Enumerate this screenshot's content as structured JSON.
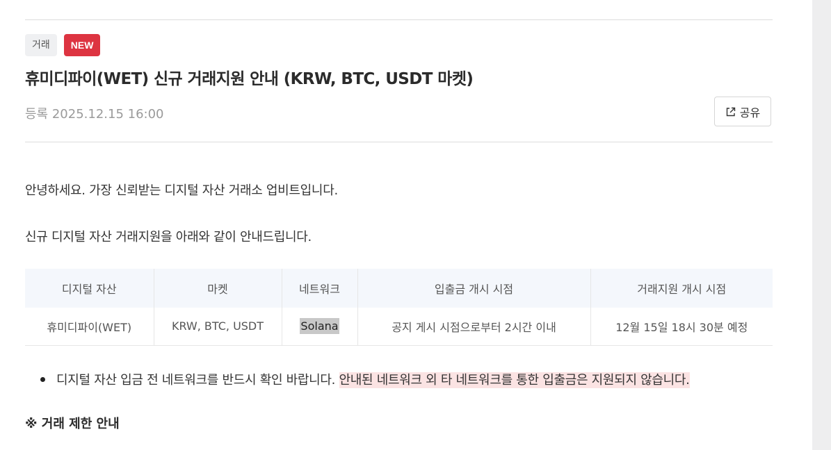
{
  "notice": {
    "category_tag": "거래",
    "new_tag": "NEW",
    "title": "휴미디파이(WET) 신규 거래지원 안내 (KRW, BTC, USDT 마켓)",
    "registered": "등록 2025.12.15 16:00",
    "share_label": "공유"
  },
  "body": {
    "greeting": "안녕하세요. 가장 신뢰받는 디지털 자산 거래소 업비트입니다.",
    "intro": "신규 디지털 자산 거래지원을 아래와 같이 안내드립니다.",
    "table": {
      "headers": [
        "디지털 자산",
        "마켓",
        "네트워크",
        "입출금 개시 시점",
        "거래지원 개시 시점"
      ],
      "rows": [
        [
          "휴미디파이(WET)",
          "KRW, BTC, USDT",
          "Solana",
          "공지 게시 시점으로부터 2시간 이내",
          "12월 15일 18시 30분 예정"
        ]
      ]
    },
    "bullet_plain": "디지털 자산 입금 전 네트워크를 반드시 확인 바랍니다. ",
    "bullet_highlight": "안내된 네트워크 외 타 네트워크를 통한 입출금은 지원되지 않습니다.",
    "section_title": "※ 거래 제한 안내"
  },
  "colors": {
    "new_tag": "#dd3441",
    "highlight_red": "#fbe3e3",
    "highlight_gray": "#c8c8c8",
    "table_header_bg": "#f4f7fc"
  },
  "icons": {
    "share": "share-icon"
  }
}
